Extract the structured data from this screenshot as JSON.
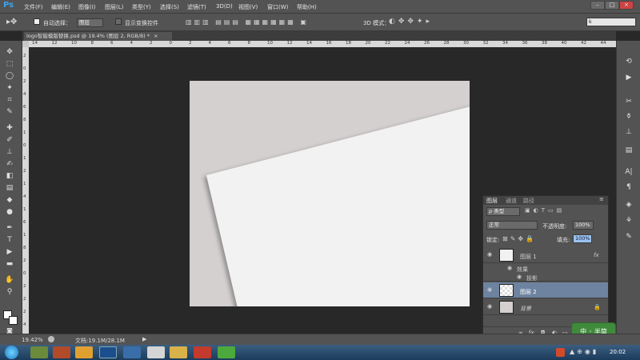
{
  "app": {
    "logo": "Ps"
  },
  "menu": [
    "文件(F)",
    "编辑(E)",
    "图像(I)",
    "图层(L)",
    "类型(Y)",
    "选择(S)",
    "滤镜(T)",
    "3D(D)",
    "视图(V)",
    "窗口(W)",
    "帮助(H)"
  ],
  "window_buttons": [
    "–",
    "□",
    "×"
  ],
  "options": {
    "auto_select_label": "自动选择：",
    "auto_select_value": "图层",
    "show_transform_label": "显示变换控件",
    "mode_3d_label": "3D 模式：",
    "workspace_value": "k"
  },
  "document_tab": {
    "title": "logo智能模版替换.psd @ 19.4% (图层 2, RGB/8) *",
    "close": "×"
  },
  "ruler_top": [
    "14",
    "12",
    "10",
    "8",
    "6",
    "4",
    "2",
    "0",
    "2",
    "4",
    "6",
    "8",
    "10",
    "12",
    "14",
    "16",
    "18",
    "20",
    "22",
    "24",
    "26",
    "28",
    "30",
    "32",
    "34",
    "36",
    "38",
    "40",
    "42",
    "44"
  ],
  "ruler_left": [
    "2",
    "0",
    "2",
    "4",
    "6",
    "8",
    "1",
    "0",
    "1",
    "2",
    "1",
    "4",
    "1",
    "6",
    "1",
    "8",
    "2",
    "0",
    "2",
    "2",
    "2",
    "4"
  ],
  "layers_panel": {
    "tabs": [
      "图层",
      "通道",
      "路径"
    ],
    "filter_label": "ρ 类型",
    "blend_mode": "正常",
    "opacity_label": "不透明度:",
    "opacity_value": "100%",
    "lock_label": "锁定:",
    "fill_label": "填充:",
    "fill_value": "100%",
    "layers": [
      {
        "name": "图层 1",
        "fx": "fx"
      },
      {
        "name": "效果"
      },
      {
        "name": "投影"
      },
      {
        "name": "图层 2"
      },
      {
        "name": "背景"
      }
    ],
    "footer_icons": [
      "∞",
      "fx",
      "◘",
      "◐",
      "▭",
      "▤",
      "🗑"
    ]
  },
  "status": {
    "zoom": "19.42%",
    "doc": "文档:19.1M/28.1M"
  },
  "taskbar": {
    "time": "20:02"
  },
  "watermark": {
    "text": "中 ◦ 半简"
  }
}
